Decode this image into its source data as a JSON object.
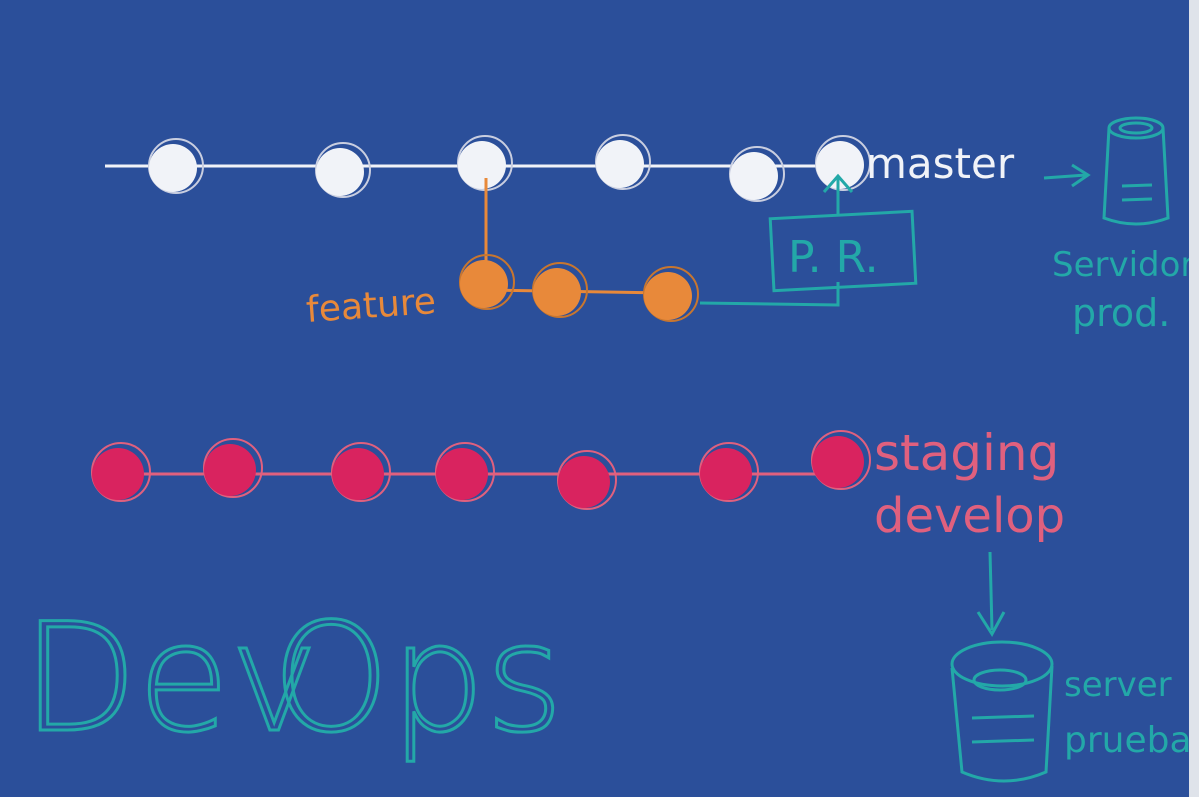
{
  "colors": {
    "background": "#2b4f9a",
    "master": "#f1f3f8",
    "feature": "#e8893a",
    "develop": "#d9235f",
    "develop_text": "#e0607e",
    "teal": "#23a8a8"
  },
  "branches": {
    "master": {
      "label": "master",
      "commit_count": 6
    },
    "feature": {
      "label": "feature",
      "commit_count": 3
    },
    "develop": {
      "label_top": "staging",
      "label_bottom": "develop",
      "commit_count": 7
    }
  },
  "pull_request": {
    "label": "P. R."
  },
  "servers": {
    "production": {
      "line1": "Servidor",
      "line2": "prod."
    },
    "testing": {
      "line1": "server",
      "line2": "pruebas"
    }
  },
  "title": {
    "part1": "Dev",
    "part2": "Ops"
  },
  "icons": {
    "arrow_master_to_server": "arrow-right-icon",
    "arrow_develop_to_server": "arrow-down-icon",
    "prod_server": "database-icon",
    "test_server": "database-icon"
  }
}
